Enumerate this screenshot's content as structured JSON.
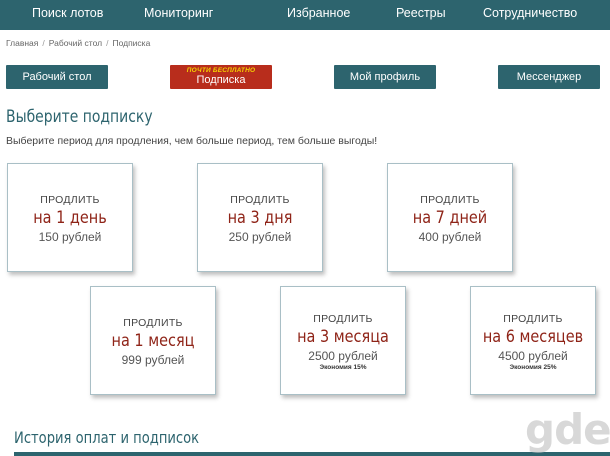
{
  "nav": {
    "items": [
      "Поиск лотов",
      "Мониторинг",
      "Избранное",
      "Реестры",
      "Сотрудничество"
    ]
  },
  "breadcrumb": {
    "items": [
      "Главная",
      "Рабочий стол",
      "Подписка"
    ]
  },
  "buttons": {
    "desktop": "Рабочий стол",
    "subscription_promo": "ПОЧТИ БЕСПЛАТНО",
    "subscription": "Подписка",
    "profile": "Мой профиль",
    "messenger": "Мессенджер"
  },
  "page": {
    "title": "Выберите подписку",
    "subtitle": "Выберите период для продления, чем больше период, тем больше выгоды!"
  },
  "plans": [
    {
      "label": "ПРОДЛИТЬ",
      "period": "на 1 день",
      "price": "150 рублей",
      "saving": ""
    },
    {
      "label": "ПРОДЛИТЬ",
      "period": "на 3 дня",
      "price": "250 рублей",
      "saving": ""
    },
    {
      "label": "ПРОДЛИТЬ",
      "period": "на 7 дней",
      "price": "400 рублей",
      "saving": ""
    },
    {
      "label": "ПРОДЛИТЬ",
      "period": "на 1 месяц",
      "price": "999 рублей",
      "saving": ""
    },
    {
      "label": "ПРОДЛИТЬ",
      "period": "на 3 месяца",
      "price": "2500 рублей",
      "saving": "Экономия 15%"
    },
    {
      "label": "ПРОДЛИТЬ",
      "period": "на 6 месяцев",
      "price": "4500 рублей",
      "saving": "Экономия 25%"
    }
  ],
  "history": {
    "title": "История оплат и подписок"
  },
  "watermark": "gde"
}
